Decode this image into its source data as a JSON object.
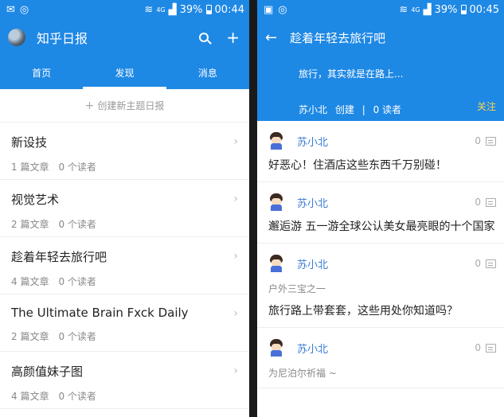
{
  "left": {
    "status": {
      "battery": "39%",
      "time": "00:44",
      "network": "4G"
    },
    "appbar": {
      "title": "知乎日报",
      "add": "+"
    },
    "tabs": [
      {
        "label": "首页"
      },
      {
        "label": "发现"
      },
      {
        "label": "消息"
      }
    ],
    "create": {
      "plus": "+",
      "label": "创建新主题日报"
    },
    "items": [
      {
        "name": "新设技",
        "articles": "1 篇文章",
        "readers": "0 个读者"
      },
      {
        "name": "视觉艺术",
        "articles": "2 篇文章",
        "readers": "0 个读者"
      },
      {
        "name": "趁着年轻去旅行吧",
        "articles": "4 篇文章",
        "readers": "0 个读者"
      },
      {
        "name": "The Ultimate Brain Fxck Daily",
        "articles": "2 篇文章",
        "readers": "0 个读者"
      },
      {
        "name": "高颜值妹子图",
        "articles": "4 篇文章",
        "readers": "0 个读者"
      }
    ]
  },
  "right": {
    "status": {
      "battery": "39%",
      "time": "00:45",
      "network": "4G"
    },
    "appbar": {
      "back": "←",
      "title": "趁着年轻去旅行吧"
    },
    "header": {
      "description": "旅行，其实就是在路上...",
      "creator": "苏小北",
      "created": "创建",
      "separator": "|",
      "readers": "0 读者",
      "follow": "关注"
    },
    "posts": [
      {
        "author": "苏小北",
        "comments": "0",
        "subtitle": "",
        "title": "好恶心！住酒店这些东西千万别碰！"
      },
      {
        "author": "苏小北",
        "comments": "0",
        "subtitle": "",
        "title": "邂逅游 五一游全球公认美女最亮眼的十个国家"
      },
      {
        "author": "苏小北",
        "comments": "0",
        "subtitle": "户外三宝之一",
        "title": "旅行路上带套套，这些用处你知道吗？"
      },
      {
        "author": "苏小北",
        "comments": "0",
        "subtitle": "为尼泊尔祈福 ~",
        "title": ""
      }
    ]
  }
}
